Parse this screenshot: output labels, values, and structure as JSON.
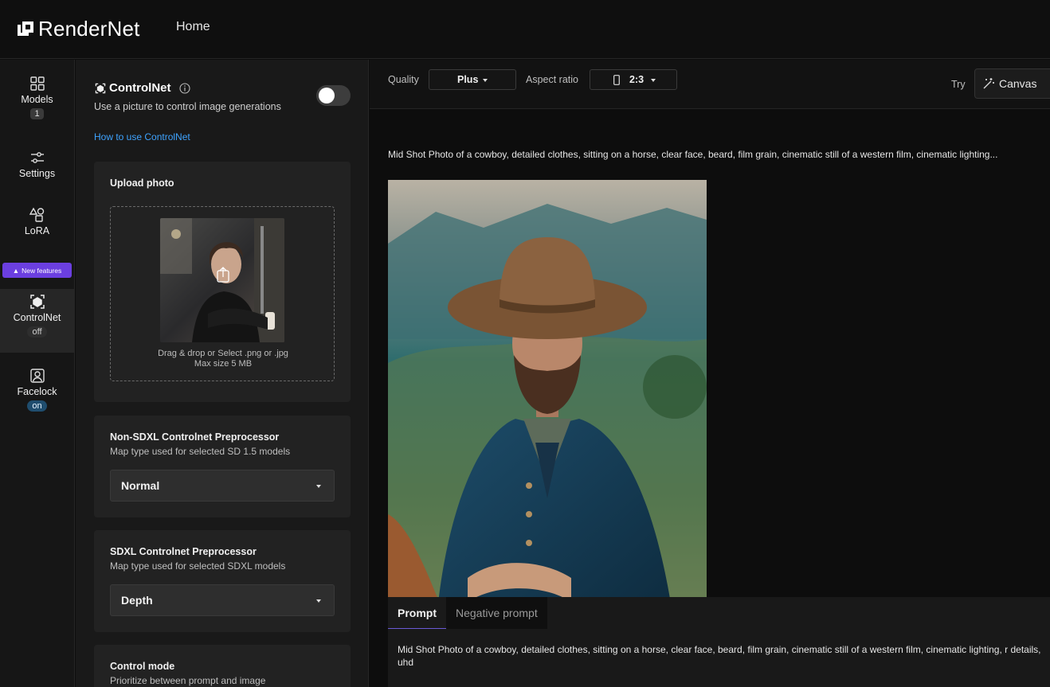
{
  "header": {
    "brand": "RenderNet",
    "nav_home": "Home"
  },
  "rail": {
    "items": [
      {
        "label": "Models",
        "badge": "1",
        "icon": "grid-icon"
      },
      {
        "label": "Settings",
        "icon": "sliders-icon"
      },
      {
        "label": "LoRA",
        "icon": "shapes-icon"
      },
      {
        "label": "ControlNet",
        "badge": "off",
        "icon": "controlnet-icon"
      },
      {
        "label": "Facelock",
        "badge": "on",
        "icon": "face-frame-icon"
      }
    ],
    "new_features": "New features"
  },
  "panel": {
    "controlnet_title": "ControlNet",
    "controlnet_subtitle": "Use a picture to control image generations",
    "controlnet_enabled": false,
    "how_to_link": "How to use ControlNet",
    "upload": {
      "title": "Upload photo",
      "hint_line1": "Drag & drop or Select .png or .jpg",
      "hint_line2": "Max size 5 MB"
    },
    "non_sdxl": {
      "title": "Non-SDXL Controlnet Preprocessor",
      "subtitle": "Map type used for selected SD 1.5 models",
      "value": "Normal"
    },
    "sdxl": {
      "title": "SDXL Controlnet Preprocessor",
      "subtitle": "Map type used for selected SDXL models",
      "value": "Depth"
    },
    "control_mode": {
      "title": "Control mode",
      "subtitle": "Prioritize between prompt and image"
    }
  },
  "toolbar": {
    "quality_label": "Quality",
    "quality_value": "Plus",
    "aspect_label": "Aspect ratio",
    "aspect_value": "2:3",
    "try_label": "Try",
    "canvas_label": "Canvas"
  },
  "main": {
    "prompt_preview": "Mid Shot Photo of a cowboy, detailed clothes, sitting on a horse, clear face, beard, film grain, cinematic still of a western film, cinematic lighting...",
    "tabs": [
      "Prompt",
      "Negative prompt"
    ],
    "prompt_full": "Mid Shot Photo of a cowboy, detailed clothes, sitting on a horse, clear face, beard, film grain, cinematic still of a western film, cinematic lighting, r details, uhd"
  }
}
